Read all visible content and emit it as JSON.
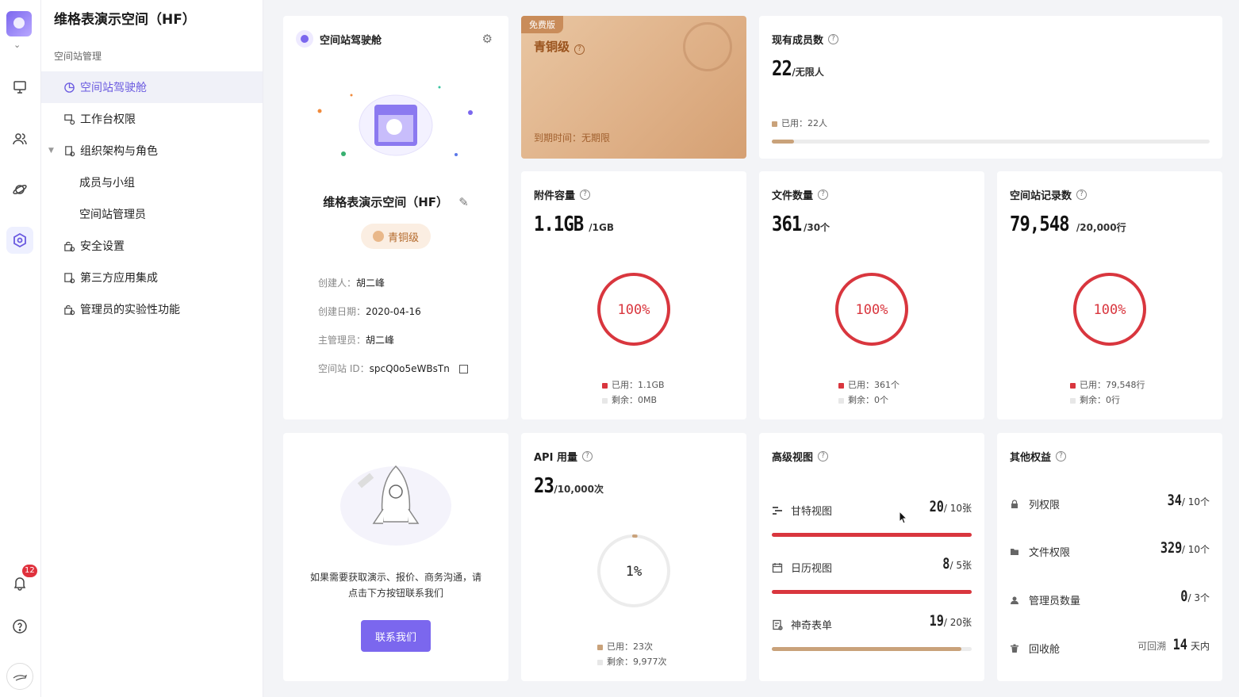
{
  "rail": {
    "notifications_badge": "12"
  },
  "sidebar": {
    "space_title": "维格表演示空间（HF）",
    "section_label": "空间站管理",
    "items": [
      {
        "label": "空间站驾驶舱"
      },
      {
        "label": "工作台权限"
      },
      {
        "label": "组织架构与角色"
      },
      {
        "label": "成员与小组"
      },
      {
        "label": "空间站管理员"
      },
      {
        "label": "安全设置"
      },
      {
        "label": "第三方应用集成"
      },
      {
        "label": "管理员的实验性功能"
      }
    ]
  },
  "cockpit": {
    "header": "空间站驾驶舱",
    "space_name": "维格表演示空间（HF）",
    "tier": "青铜级",
    "creator_label": "创建人：",
    "creator": "胡二峰",
    "created_label": "创建日期：",
    "created": "2020-04-16",
    "admin_label": "主管理员：",
    "admin": "胡二峰",
    "space_id_label": "空间站 ID：",
    "space_id": "spcQ0o5eWBsTn"
  },
  "bronze": {
    "tag": "免费版",
    "title": "青铜级",
    "expiry_label": "到期时间：",
    "expiry": "无期限"
  },
  "members": {
    "title": "现有成员数",
    "value": "22",
    "unit": "/无限人",
    "used_label": "已用：",
    "used": "22人",
    "fraction": 0.05
  },
  "attachments": {
    "title": "附件容量",
    "value": "1.1GB",
    "unit": "/1GB",
    "percent": "100%",
    "ratio": 1.0,
    "used_label": "已用：",
    "used": "1.1GB",
    "remain_label": "剩余：",
    "remain": "0MB"
  },
  "files": {
    "title": "文件数量",
    "value": "361",
    "unit": "/30个",
    "percent": "100%",
    "ratio": 1.0,
    "used_label": "已用：",
    "used": "361个",
    "remain_label": "剩余：",
    "remain": "0个"
  },
  "records": {
    "title": "空间站记录数",
    "value": "79,548",
    "unit": "/20,000行",
    "percent": "100%",
    "ratio": 1.0,
    "used_label": "已用：",
    "used": "79,548行",
    "remain_label": "剩余：",
    "remain": "0行"
  },
  "contact": {
    "text_line1": "如果需要获取演示、报价、商务沟通，请",
    "text_line2": "点击下方按钮联系我们",
    "button": "联系我们"
  },
  "api": {
    "title": "API 用量",
    "value": "23",
    "unit": "/10,000次",
    "percent": "1%",
    "ratio": 0.01,
    "used_label": "已用：",
    "used": "23次",
    "remain_label": "剩余：",
    "remain": "9,977次"
  },
  "views": {
    "title": "高级视图",
    "items": [
      {
        "name": "甘特视图",
        "value": "20",
        "unit": "/ 10张",
        "fraction": 1.0,
        "color": "#d9363e"
      },
      {
        "name": "日历视图",
        "value": "8",
        "unit": "/ 5张",
        "fraction": 1.0,
        "color": "#d9363e"
      },
      {
        "name": "神奇表单",
        "value": "19",
        "unit": "/ 20张",
        "fraction": 0.95,
        "color": "#c9a27a"
      }
    ]
  },
  "perks": {
    "title": "其他权益",
    "items": [
      {
        "name": "列权限",
        "value": "34",
        "unit": "/ 10个"
      },
      {
        "name": "文件权限",
        "value": "329",
        "unit": "/ 10个"
      },
      {
        "name": "管理员数量",
        "value": "0",
        "unit": "/ 3个"
      },
      {
        "name": "回收舱",
        "prefix": "可回溯",
        "value": "14",
        "unit": "天内"
      }
    ]
  },
  "colors": {
    "accent": "#7b67ee",
    "danger": "#d9363e",
    "bronze": "#c9a27a"
  }
}
